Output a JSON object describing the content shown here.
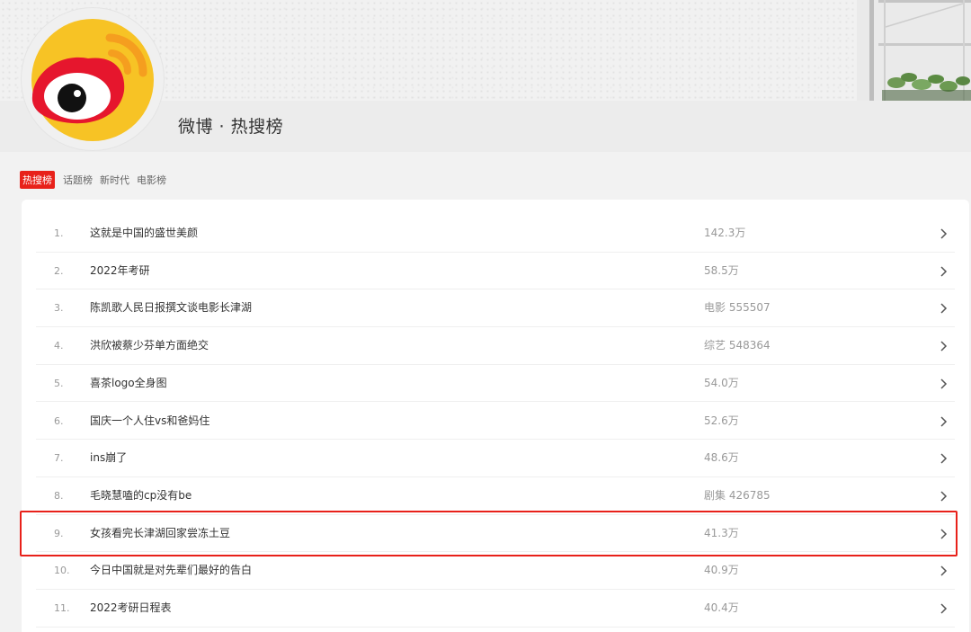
{
  "page": {
    "title": "微博 · 热搜榜"
  },
  "tabs": [
    {
      "label": "热搜榜",
      "active": true
    },
    {
      "label": "话题榜",
      "active": false
    },
    {
      "label": "新时代",
      "active": false
    },
    {
      "label": "电影榜",
      "active": false
    }
  ],
  "list": {
    "items": [
      {
        "rank": "1.",
        "topic": "这就是中国的盛世美颜",
        "heat": "142.3万"
      },
      {
        "rank": "2.",
        "topic": "2022年考研",
        "heat": "58.5万"
      },
      {
        "rank": "3.",
        "topic": "陈凯歌人民日报撰文谈电影长津湖",
        "heat": "电影 555507"
      },
      {
        "rank": "4.",
        "topic": "洪欣被蔡少芬单方面绝交",
        "heat": "综艺 548364"
      },
      {
        "rank": "5.",
        "topic": "喜茶logo全身图",
        "heat": "54.0万"
      },
      {
        "rank": "6.",
        "topic": "国庆一个人住vs和爸妈住",
        "heat": "52.6万"
      },
      {
        "rank": "7.",
        "topic": "ins崩了",
        "heat": "48.6万"
      },
      {
        "rank": "8.",
        "topic": "毛晓慧嗑的cp没有be",
        "heat": "剧集 426785"
      },
      {
        "rank": "9.",
        "topic": "女孩看完长津湖回家尝冻土豆",
        "heat": "41.3万",
        "highlighted": true
      },
      {
        "rank": "10.",
        "topic": "今日中国就是对先辈们最好的告白",
        "heat": "40.9万"
      },
      {
        "rank": "11.",
        "topic": "2022考研日程表",
        "heat": "40.4万"
      }
    ]
  },
  "colors": {
    "accent": "#e8211a",
    "logo_yellow": "#f7c325",
    "logo_red": "#e6162d",
    "logo_orange": "#f59e1f"
  },
  "icons": {
    "logo": "weibo-logo",
    "row_action": "chevron-right-icon"
  }
}
